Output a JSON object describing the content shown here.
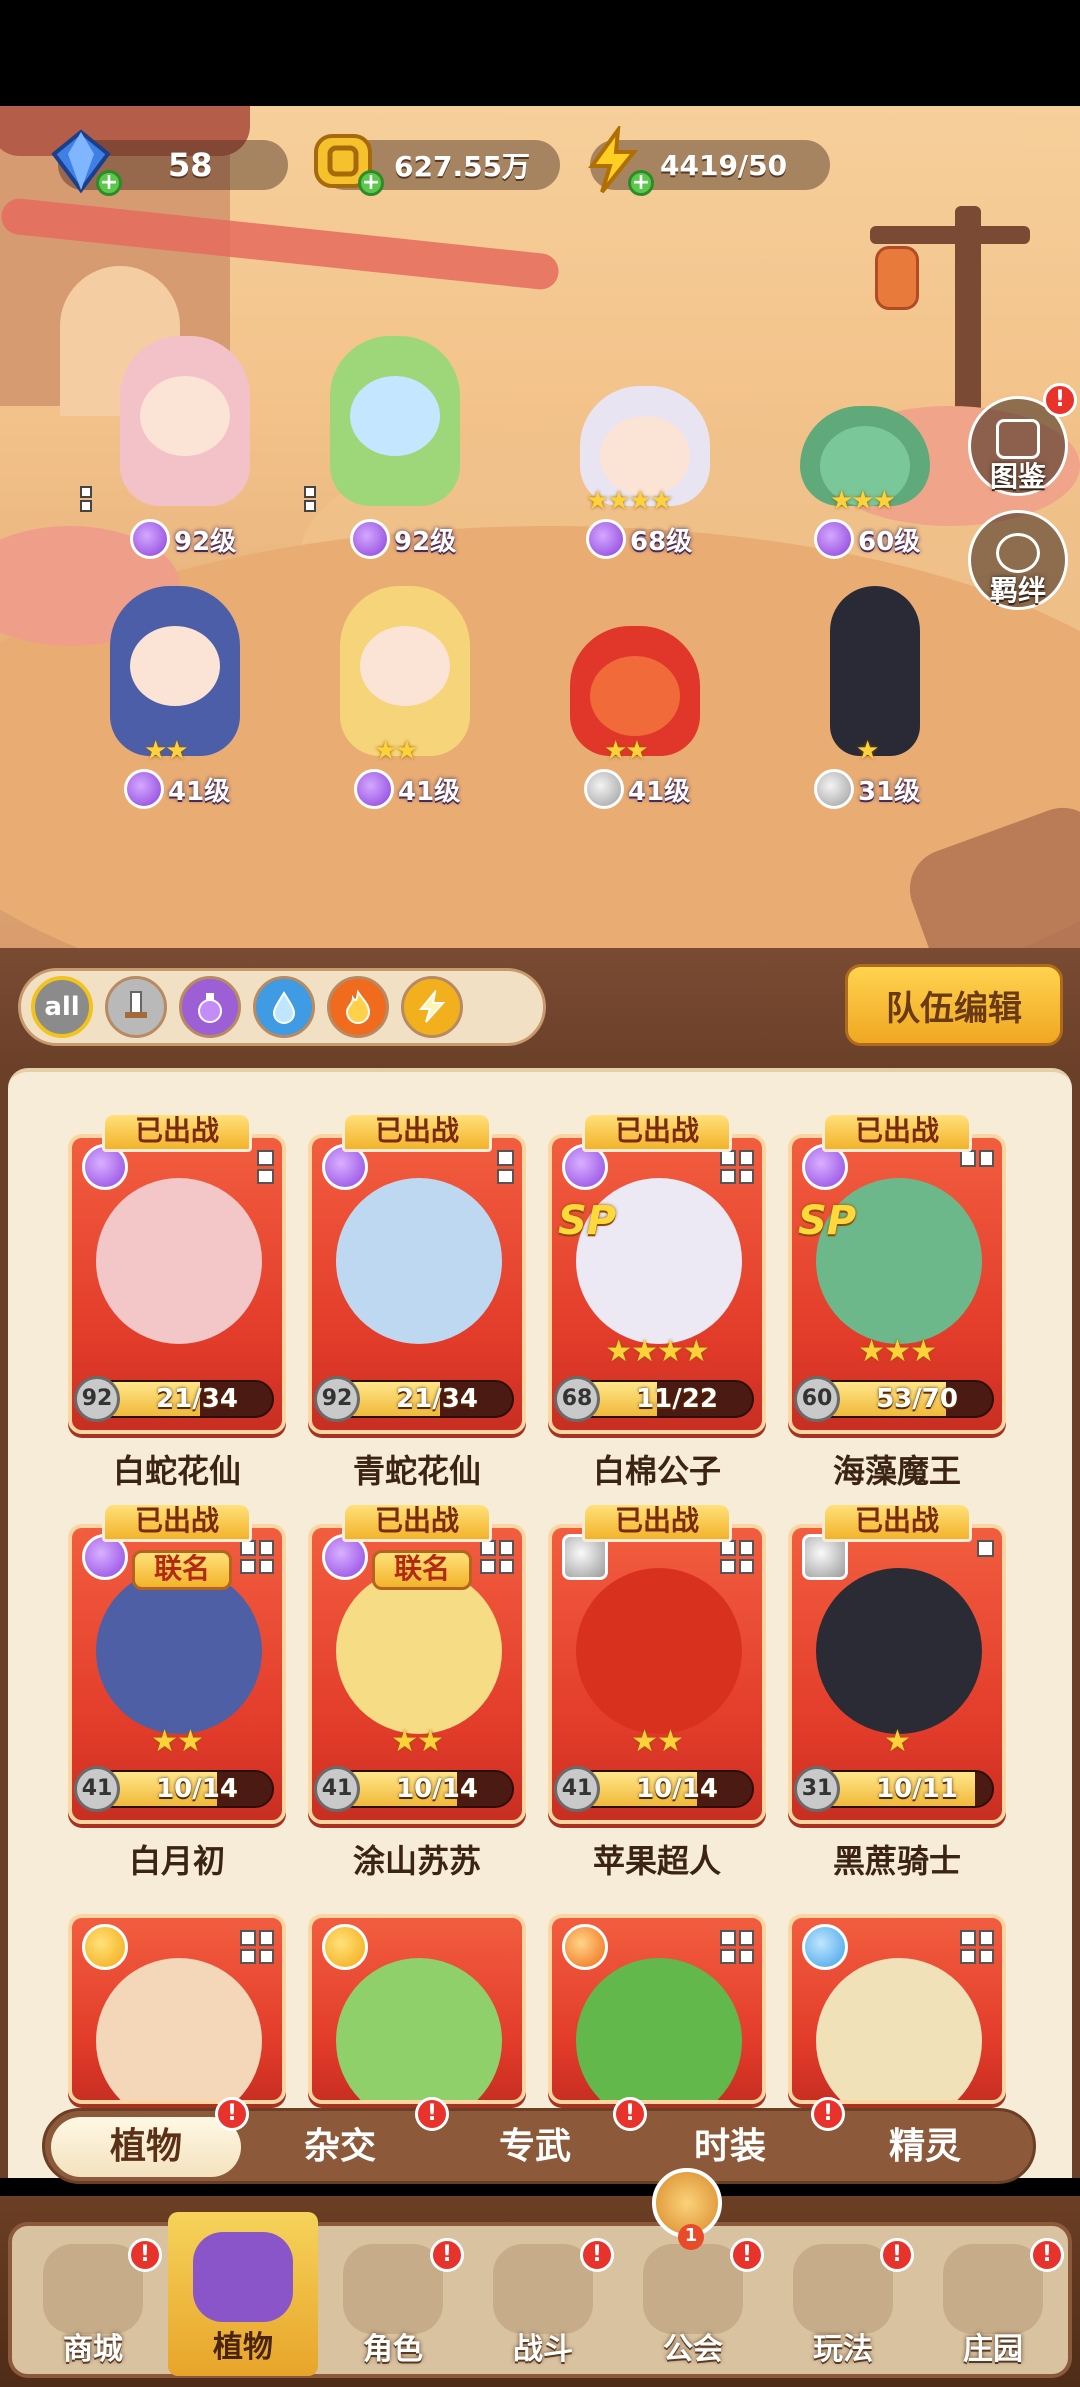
{
  "currency": {
    "gems": "58",
    "gold": "627.55万",
    "energy": "4419/50"
  },
  "side_buttons": {
    "codex": "图鉴",
    "bond": "羁绊"
  },
  "field_units": [
    {
      "level": "92级",
      "stars": "",
      "element": "potion"
    },
    {
      "level": "92级",
      "stars": "",
      "element": "potion"
    },
    {
      "level": "68级",
      "stars": "★★★★",
      "element": "potion"
    },
    {
      "level": "60级",
      "stars": "★★★",
      "element": "potion"
    },
    {
      "level": "41级",
      "stars": "★★",
      "element": "potion"
    },
    {
      "level": "41级",
      "stars": "★★",
      "element": "potion"
    },
    {
      "level": "41级",
      "stars": "★★",
      "element": "sword"
    },
    {
      "level": "31级",
      "stars": "★",
      "element": "sword"
    }
  ],
  "filters": {
    "all_label": "all",
    "icons": [
      "sword-icon",
      "potion-icon",
      "water-icon",
      "fire-icon",
      "bolt-icon"
    ]
  },
  "team_edit_label": "队伍编辑",
  "deployed_label": "已出战",
  "union_label": "联名",
  "sp_label": "SP",
  "heroes": [
    {
      "name": "白蛇花仙",
      "level": "92",
      "shards": "21/34",
      "progress": 0.62,
      "stars": "",
      "element": "potion",
      "deployed": true,
      "sp": false,
      "union": false
    },
    {
      "name": "青蛇花仙",
      "level": "92",
      "shards": "21/34",
      "progress": 0.62,
      "stars": "",
      "element": "potion",
      "deployed": true,
      "sp": false,
      "union": false
    },
    {
      "name": "白棉公子",
      "level": "68",
      "shards": "11/22",
      "progress": 0.5,
      "stars": "★★★★",
      "element": "potion",
      "deployed": true,
      "sp": true,
      "union": false
    },
    {
      "name": "海藻魔王",
      "level": "60",
      "shards": "53/70",
      "progress": 0.76,
      "stars": "★★★",
      "element": "potion",
      "deployed": true,
      "sp": true,
      "union": false
    },
    {
      "name": "白月初",
      "level": "41",
      "shards": "10/14",
      "progress": 0.71,
      "stars": "★★",
      "element": "potion",
      "deployed": true,
      "sp": false,
      "union": true
    },
    {
      "name": "涂山苏苏",
      "level": "41",
      "shards": "10/14",
      "progress": 0.71,
      "stars": "★★",
      "element": "potion",
      "deployed": true,
      "sp": false,
      "union": true
    },
    {
      "name": "苹果超人",
      "level": "41",
      "shards": "10/14",
      "progress": 0.71,
      "stars": "★★",
      "element": "sword",
      "deployed": true,
      "sp": false,
      "union": false
    },
    {
      "name": "黑蔗骑士",
      "level": "31",
      "shards": "10/11",
      "progress": 0.91,
      "stars": "★",
      "element": "sword",
      "deployed": true,
      "sp": false,
      "union": false
    }
  ],
  "partial_cards": [
    "bolt",
    "bolt",
    "fire",
    "water"
  ],
  "sub_tabs": [
    "植物",
    "杂交",
    "专武",
    "时装",
    "精灵"
  ],
  "bottom_nav": [
    "商城",
    "植物",
    "角色",
    "战斗",
    "公会",
    "玩法",
    "庄园"
  ],
  "guild_badge_count": "1",
  "alert_mark": "!",
  "colors": {
    "card_red": "#e23b2a",
    "gold": "#f3b32a",
    "frame_brown": "#6b4029",
    "panel_cream": "#f6ecd7"
  }
}
